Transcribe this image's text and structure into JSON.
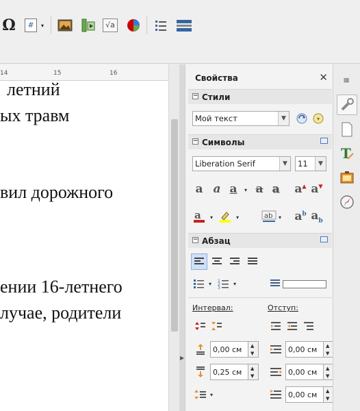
{
  "toolbar": {
    "icons": [
      "omega-icon",
      "field-icon",
      "image-icon",
      "media-icon",
      "formula-icon",
      "chart-icon",
      "bullets-icon",
      "tracking-icon"
    ],
    "special_char_glyph": "Ω",
    "field_glyph": "#",
    "formula_glyph": "√a"
  },
  "ruler": {
    "tick_14": "14",
    "tick_15": "15",
    "tick_16": "16"
  },
  "document": {
    "lines": [
      "летний",
      "ых травм",
      "вил дорожного",
      "ении 16-летнего",
      "лучае, родители"
    ]
  },
  "sidebar": {
    "title": "Свойства",
    "close_glyph": "✕",
    "styles": {
      "title": "Стили",
      "current_style": "Мой текст"
    },
    "character": {
      "title": "Символы",
      "font_name": "Liberation Serif",
      "font_size": "11"
    },
    "paragraph": {
      "title": "Абзац",
      "spacing_label": "Интервал:",
      "indent_label": "Отступ:",
      "above_spacing": "0,00 см",
      "below_spacing": "0,25 см",
      "before_indent": "0,00 см",
      "after_indent": "0,00 см",
      "first_line_indent": "0,00 см"
    }
  },
  "tabbar": {
    "items": [
      "properties-icon",
      "page-icon",
      "styles-icon",
      "gallery-icon",
      "navigator-icon"
    ]
  },
  "colors": {
    "font_color": "#c9211e",
    "highlight_color": "#ffff00",
    "accent": "#3465a4"
  }
}
